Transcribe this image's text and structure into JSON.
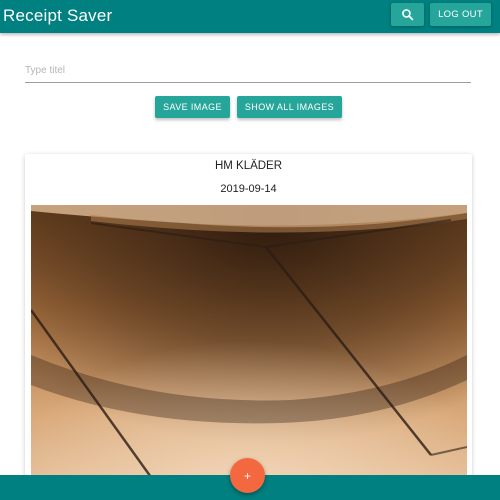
{
  "app": {
    "title": "Receipt Saver"
  },
  "header": {
    "search_icon": "search-icon",
    "logout_label": "LOG OUT"
  },
  "form": {
    "title_placeholder": "Type titel",
    "title_value": "",
    "save_label": "SAVE IMAGE",
    "show_all_label": "SHOW ALL IMAGES"
  },
  "receipt": {
    "title": "HM KLÄDER",
    "date": "2019-09-14"
  },
  "fab": {
    "label": "+"
  },
  "colors": {
    "primary": "#008080",
    "button": "#26a69a",
    "fab": "#f4683f"
  }
}
